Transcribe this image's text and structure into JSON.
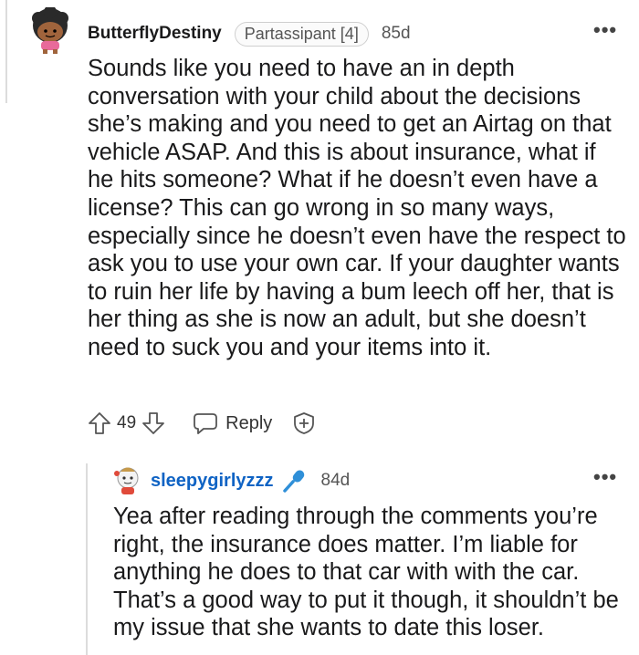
{
  "comment": {
    "author": "ButterflyDestiny",
    "flair": "Partassipant [4]",
    "age": "85d",
    "menu": "•••",
    "body": "Sounds like you need to have an in depth conversation with your child about the decisions she’s making and you need to get an Airtag on that vehicle ASAP. And this is about insurance, what if he hits someone? What if he doesn’t even have a license? This can go wrong in so many ways, especially since he doesn’t even have the respect to ask you to use your own car. If your daughter wants to ruin her life by having a bum leech off her, that is her thing as she is now an adult, but she doesn’t need to suck you and your items into it.",
    "votes": "49",
    "reply_label": "Reply"
  },
  "reply": {
    "author": "sleepygirlyzzz",
    "age": "84d",
    "menu": "•••",
    "body": "Yea after reading through the comments you’re right, the insurance does matter. I’m liable for anything he does to that car with with the car. That’s a good way to put it though, it shouldn’t be my issue that she wants to date this loser."
  },
  "icons": {
    "upvote": "upvote-arrow-icon",
    "downvote": "downvote-arrow-icon",
    "reply": "speech-bubble-icon",
    "award": "plus-shield-icon",
    "mic": "microphone-icon"
  },
  "colors": {
    "reply_username": "#0f63c4",
    "mic": "#2f8fd8",
    "thread_line": "#dcdcdc"
  }
}
